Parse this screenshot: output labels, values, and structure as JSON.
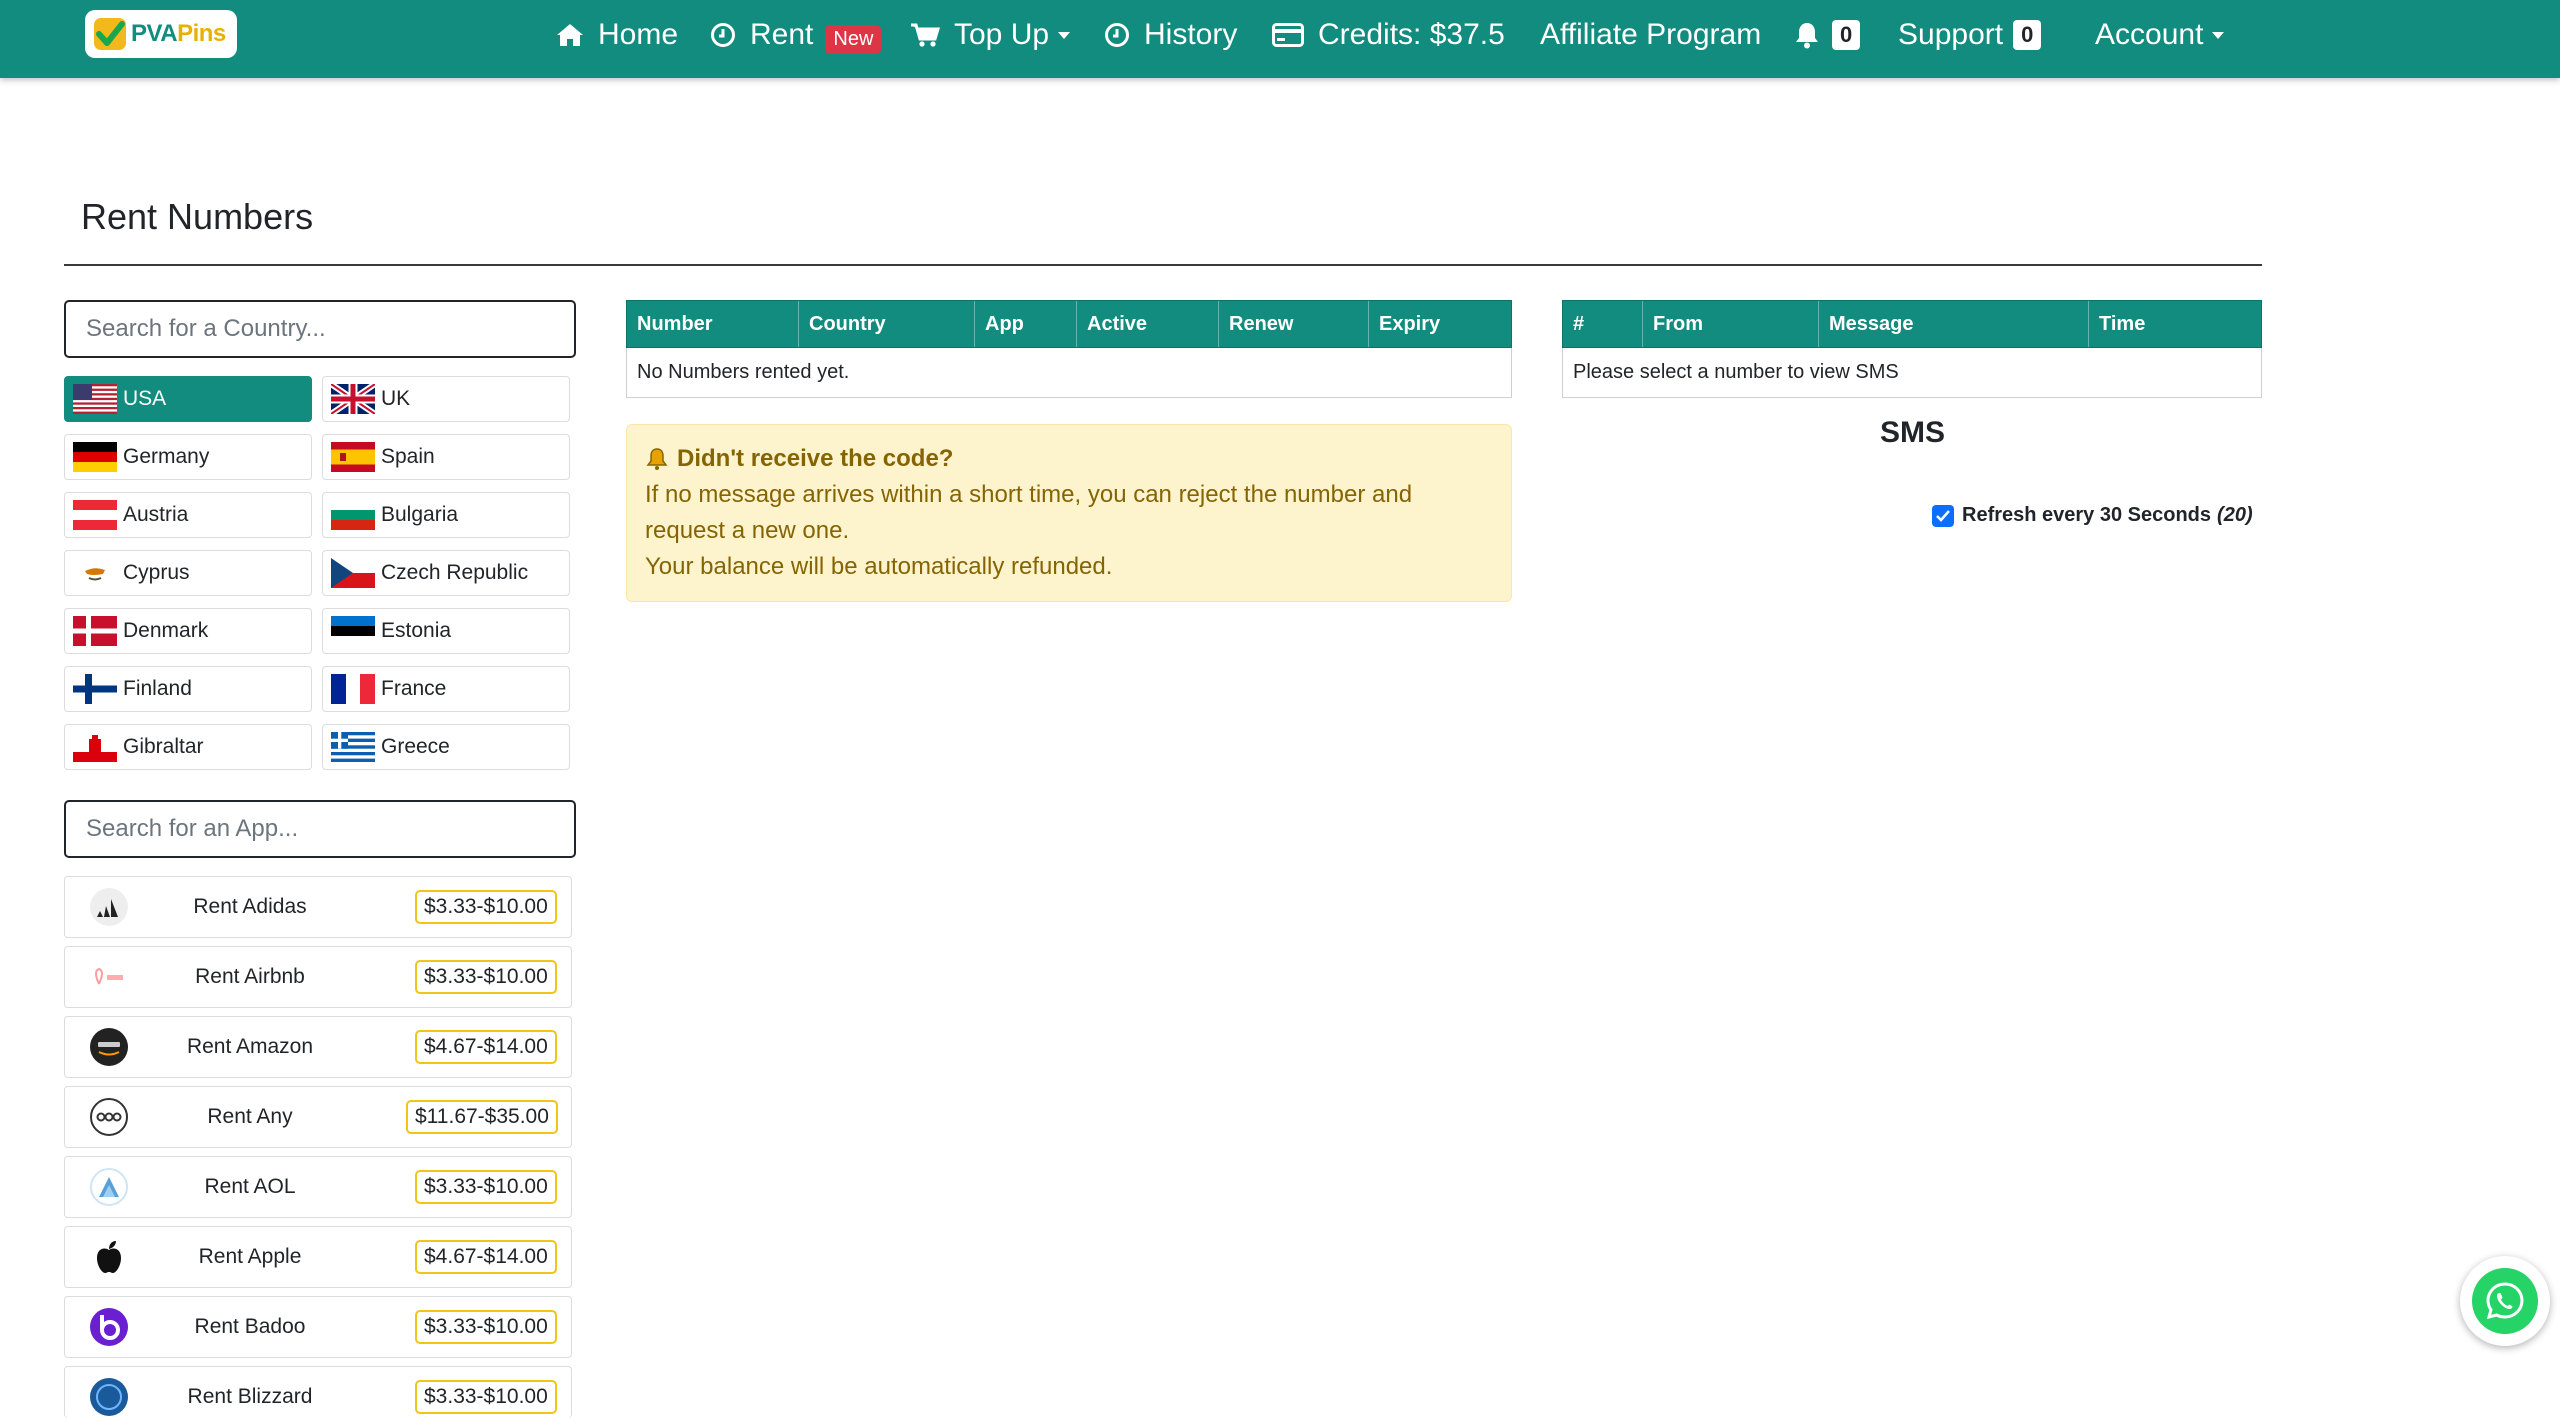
{
  "navbar": {
    "logo": {
      "text_a": "PVA",
      "text_b": "Pins"
    },
    "home": "Home",
    "rent": "Rent",
    "rent_badge": "New",
    "topup": "Top Up",
    "history": "History",
    "credits": "Credits: $37.5",
    "affiliate": "Affiliate Program",
    "notifications_count": "0",
    "support": "Support",
    "support_count": "0",
    "account": "Account"
  },
  "page": {
    "title": "Rent Numbers"
  },
  "country_search": {
    "placeholder": "Search for a Country..."
  },
  "countries": [
    {
      "name": "USA",
      "active": true
    },
    {
      "name": "UK"
    },
    {
      "name": "Germany"
    },
    {
      "name": "Spain"
    },
    {
      "name": "Austria"
    },
    {
      "name": "Bulgaria"
    },
    {
      "name": "Cyprus"
    },
    {
      "name": "Czech Republic"
    },
    {
      "name": "Denmark"
    },
    {
      "name": "Estonia"
    },
    {
      "name": "Finland"
    },
    {
      "name": "France"
    },
    {
      "name": "Gibraltar"
    },
    {
      "name": "Greece"
    }
  ],
  "app_search": {
    "placeholder": "Search for an App..."
  },
  "apps": [
    {
      "label": "Rent Adidas",
      "price": "$3.33-$10.00",
      "icon": "adidas-icon"
    },
    {
      "label": "Rent Airbnb",
      "price": "$3.33-$10.00",
      "icon": "airbnb-icon"
    },
    {
      "label": "Rent Amazon",
      "price": "$4.67-$14.00",
      "icon": "amazon-icon"
    },
    {
      "label": "Rent Any",
      "price": "$11.67-$35.00",
      "icon": "any-icon"
    },
    {
      "label": "Rent AOL",
      "price": "$3.33-$10.00",
      "icon": "aol-icon"
    },
    {
      "label": "Rent Apple",
      "price": "$4.67-$14.00",
      "icon": "apple-icon"
    },
    {
      "label": "Rent Badoo",
      "price": "$3.33-$10.00",
      "icon": "badoo-icon"
    },
    {
      "label": "Rent Blizzard",
      "price": "$3.33-$10.00",
      "icon": "blizzard-icon"
    }
  ],
  "numbers_table": {
    "headers": [
      "Number",
      "Country",
      "App",
      "Active",
      "Renew",
      "Expiry"
    ],
    "empty_text": "No Numbers rented yet."
  },
  "alert": {
    "title": "Didn't receive the code?",
    "line1": "If no message arrives within a short time, you can reject the number and",
    "line2": "request a new one.",
    "line3": "Your balance will be automatically refunded."
  },
  "sms_table": {
    "headers": [
      "#",
      "From",
      "Message",
      "Time"
    ],
    "empty_text": "Please select a number to view SMS"
  },
  "sms": {
    "title": "SMS",
    "refresh_label": "Refresh every 30 Seconds",
    "refresh_countdown": "(20)",
    "refresh_checked": true
  },
  "colors": {
    "brand": "#128c7e",
    "badge_new": "#dc3545",
    "alert_bg": "#fdf3cd",
    "price_border": "#f0c419",
    "whatsapp": "#25d366"
  }
}
